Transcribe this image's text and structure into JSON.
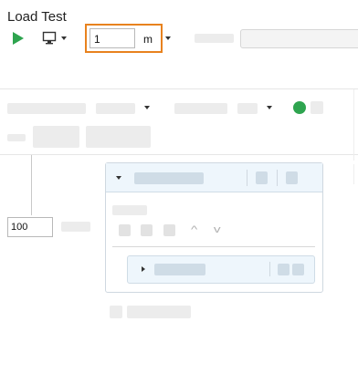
{
  "app": {
    "title": "Load Test"
  },
  "toolbar": {
    "duration_value": "1",
    "duration_unit": "m",
    "accent_color": "#e8821e",
    "run_color": "#2ea44f"
  },
  "canvas": {
    "users_value": "100"
  },
  "icons": {
    "run": "play-icon",
    "machine": "monitor-icon",
    "status": "green-status-dot-icon"
  }
}
